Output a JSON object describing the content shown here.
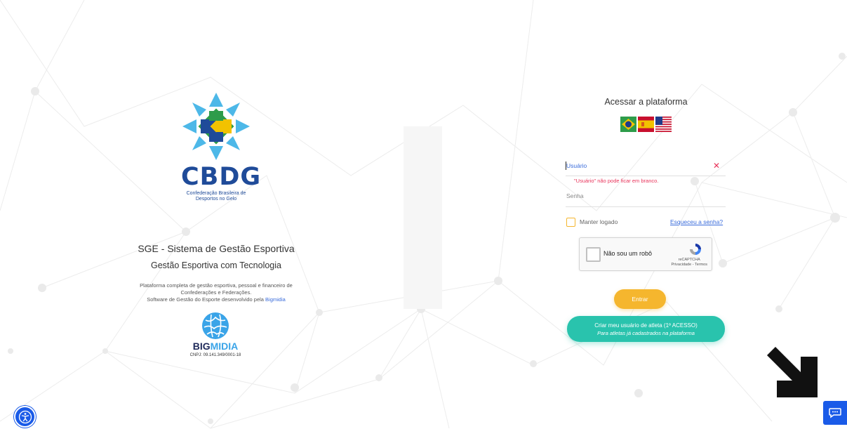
{
  "brand": {
    "org_acronym": "CBDG",
    "org_name_line1": "Confederação Brasileira de",
    "org_name_line2": "Desportos no Gelo",
    "colors": {
      "cbdg_blue": "#1f4b99",
      "green": "#2e9c4a",
      "yellow": "#f2c200",
      "light_blue": "#4db8e8"
    }
  },
  "intro": {
    "title": "SGE - Sistema de Gestão Esportiva",
    "subtitle": "Gestão Esportiva com Tecnologia",
    "desc_line1": "Plataforma completa de gestão esportiva, pessoal e financeiro de",
    "desc_line2": "Confederações e Federações.",
    "desc_line3_prefix": "Software de Gestão do Esporte desenvolvido pela ",
    "desc_link": "Bigmidia"
  },
  "bigmidia": {
    "name_part1": "BIG",
    "name_part2": "MIDIA",
    "cnpj": "CNPJ: 09.141.349/0001-18"
  },
  "login": {
    "title": "Acessar a plataforma",
    "languages": [
      "pt-BR-flag-icon",
      "es-flag-icon",
      "en-US-flag-icon"
    ],
    "user_placeholder": "Usuário",
    "user_error": "\"Usuário\" não pode ficar em branco.",
    "password_placeholder": "Senha",
    "remember_label": "Manter logado",
    "forgot_label": "Esqueceu a senha?",
    "recaptcha": {
      "label": "Não sou um robô",
      "brand": "reCAPTCHA",
      "links": "Privacidade - Termos"
    },
    "submit_label": "Entrar",
    "athlete_button_line1": "Criar meu usuário de atleta (1º ACESSO)",
    "athlete_button_line2": "Para atletas já cadastrados na plataforma",
    "colors": {
      "accent_yellow": "#f5b62e",
      "accent_teal": "#29c3ad",
      "error": "#e8335a",
      "link": "#3a6cdb"
    }
  },
  "widgets": {
    "accessibility_icon": "accessibility-icon",
    "chat_icon": "chat-bubble-icon",
    "pointer_icon": "arrow-down-right-icon",
    "widget_color": "#1a5be8"
  }
}
